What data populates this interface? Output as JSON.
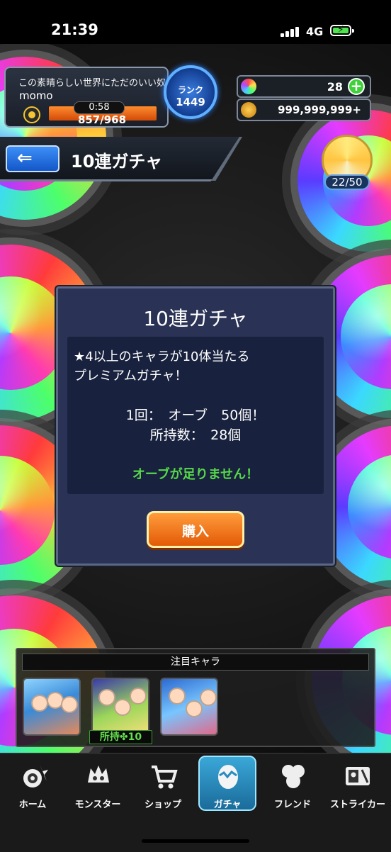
{
  "status_bar": {
    "time": "21:39",
    "network": "4G"
  },
  "player": {
    "title": "この素晴らしい世界にただのいい奴",
    "name": "momo",
    "stamina_timer": "0:58",
    "stamina": "857/968",
    "rank_label": "ランク",
    "rank": "1449"
  },
  "currency": {
    "orbs": "28",
    "gold": "999,999,999+"
  },
  "page": {
    "title": "10連ガチャ",
    "box_count": "22/50"
  },
  "dialog": {
    "title": "10連ガチャ",
    "desc_line1": "★4以上のキャラが10体当たる",
    "desc_line2": "プレミアムガチャ！",
    "cost": "1回：　オーブ　50個！",
    "owned": "所持数：　28個",
    "warning": "オーブが足りません！",
    "buy": "購入"
  },
  "featured": {
    "header": "注目キャラ",
    "owned_label": "所持✤10"
  },
  "nav": [
    {
      "label": "ホーム",
      "icon": "home-icon"
    },
    {
      "label": "モンスター",
      "icon": "monster-icon"
    },
    {
      "label": "ショップ",
      "icon": "cart-icon"
    },
    {
      "label": "ガチャ",
      "icon": "gacha-egg-icon"
    },
    {
      "label": "フレンド",
      "icon": "friends-icon"
    },
    {
      "label": "ストライカー",
      "icon": "striker-card-icon"
    }
  ],
  "colors": {
    "accent_blue": "#3d8ff7",
    "buy_orange": "#e35a07",
    "warning_green": "#56d84a"
  }
}
